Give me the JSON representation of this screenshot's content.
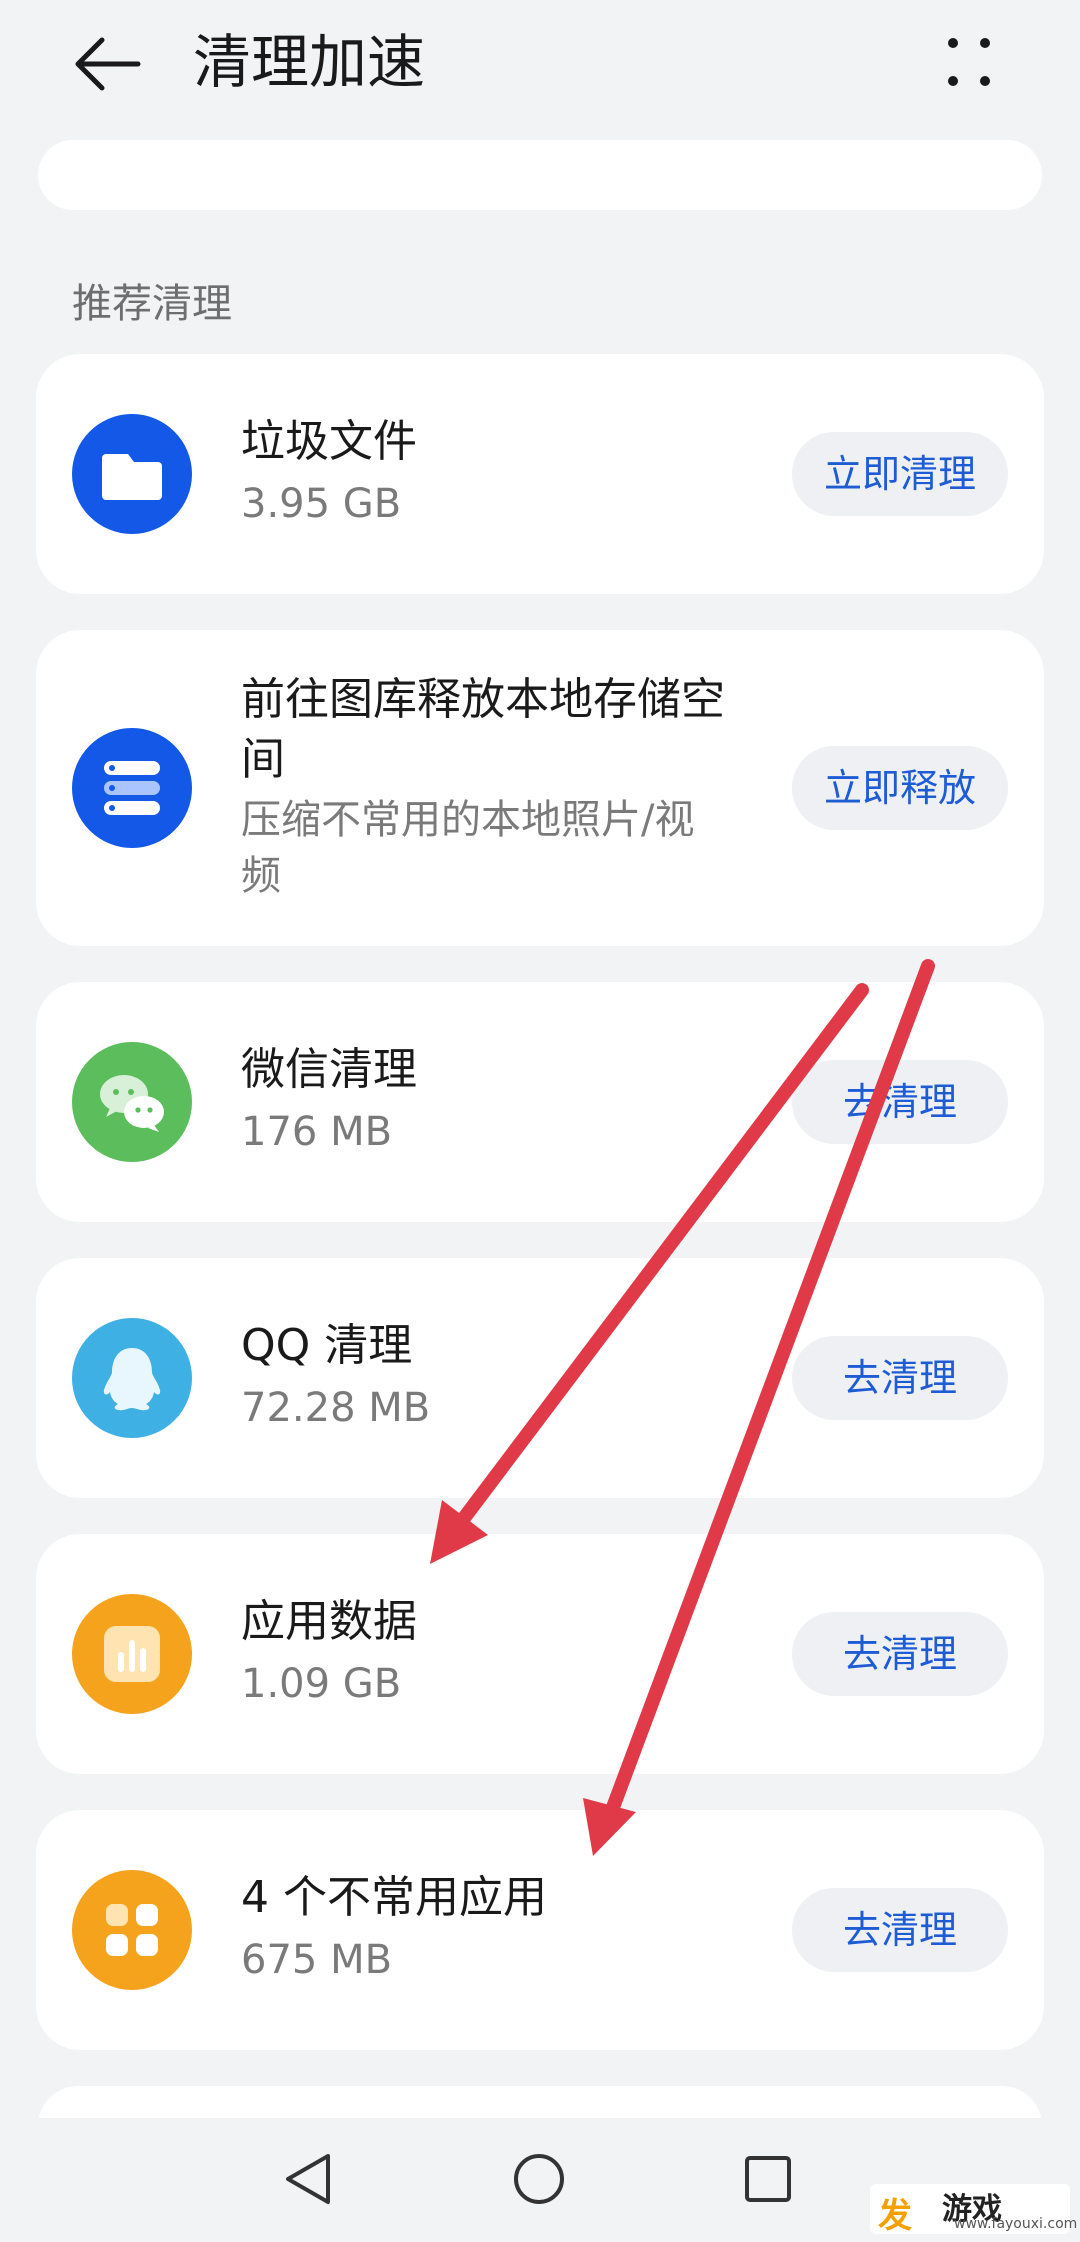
{
  "header": {
    "title": "清理加速",
    "back_icon": "arrow-left-icon",
    "more_icon": "more-dots-icon"
  },
  "section": {
    "title": "推荐清理"
  },
  "cards": [
    {
      "name": "垃圾文件",
      "sub": "3.95 GB",
      "button": "立即清理",
      "icon": "folder-icon",
      "icon_color": "#1458e8"
    },
    {
      "name_line1": "前往图库释放本地存储空",
      "name_line2": "间",
      "sub_line1": "压缩不常用的本地照片/视",
      "sub_line2": "频",
      "button": "立即释放",
      "icon": "storage-stack-icon",
      "icon_color": "#1458e8"
    },
    {
      "name": "微信清理",
      "sub": "176 MB",
      "button": "去清理",
      "icon": "wechat-icon",
      "icon_color": "#5cbd5c"
    },
    {
      "name": "QQ 清理",
      "sub": "72.28 MB",
      "button": "去清理",
      "icon": "qq-penguin-icon",
      "icon_color": "#3fb0e3"
    },
    {
      "name": "应用数据",
      "sub": "1.09 GB",
      "button": "去清理",
      "icon": "bar-chart-icon",
      "icon_color": "#f5a31c"
    },
    {
      "name": "4 个不常用应用",
      "sub": "675 MB",
      "button": "去清理",
      "icon": "app-grid-icon",
      "icon_color": "#f5a31c"
    }
  ],
  "navbar": {
    "back": "nav-back-icon",
    "home": "nav-home-icon",
    "recents": "nav-recents-icon"
  },
  "watermark": {
    "main": "游戏",
    "logo": "发",
    "sub": "www.fayouxi.com"
  },
  "annotation_color": "#e03a48"
}
